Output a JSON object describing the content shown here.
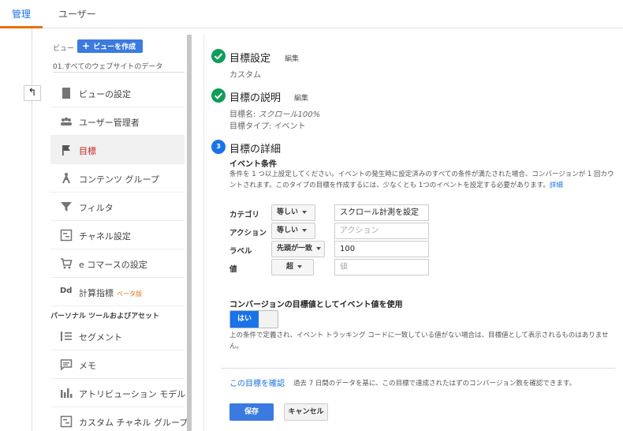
{
  "top_tabs": [
    {
      "label": "管理"
    },
    {
      "label": "ユーザー"
    }
  ],
  "back_button": {
    "icon": "arrow-back-icon"
  },
  "view": {
    "label": "ビュー",
    "create_button": "ビューを作成",
    "name": "01.すべてのウェブサイトのデータ"
  },
  "sidebar": {
    "items": [
      {
        "label": "ビューの設定",
        "icon": "document-icon"
      },
      {
        "label": "ユーザー管理者",
        "icon": "people-icon"
      },
      {
        "label": "目標",
        "icon": "flag-icon"
      },
      {
        "label": "コンテンツ グループ",
        "icon": "person-walk-icon"
      },
      {
        "label": "フィルタ",
        "icon": "funnel-icon"
      },
      {
        "label": "チャネル設定",
        "icon": "channel-icon"
      },
      {
        "label": "e コマースの設定",
        "icon": "cart-icon"
      },
      {
        "label": "計算指標",
        "icon": "dd-icon",
        "badge": "ベータ版"
      }
    ],
    "section_title": "パーソナル ツールおよびアセット",
    "personal_items": [
      {
        "label": "セグメント",
        "icon": "segment-icon"
      },
      {
        "label": "メモ",
        "icon": "memo-icon"
      },
      {
        "label": "アトリビューション モデル",
        "icon": "bar-chart-icon"
      },
      {
        "label": "カスタム チャネル グループ",
        "icon": "channel-group-icon"
      }
    ]
  },
  "steps": {
    "goal_setup": {
      "title": "目標設定",
      "edit": "編集",
      "value": "カスタム"
    },
    "goal_description": {
      "title": "目標の説明",
      "edit": "編集",
      "name_label": "目標名: ",
      "name_value": "スクロール100%",
      "type_label": "目標タイプ: ",
      "type_value": "イベント"
    },
    "goal_details": {
      "number": "3",
      "title": "目標の詳細"
    }
  },
  "event_conditions": {
    "heading": "イベント条件",
    "description": "条件を 1 つ以上設定してください。イベントの発生時に設定済みのすべての条件が満たされた場合、コンバージョンが 1 回カウントされます。このタイプの目標を作成するには、少なくとも 1つのイベントを設定する必要があります。",
    "details_link": "詳細",
    "rows": [
      {
        "label": "カテゴリ",
        "operator": "等しい",
        "value": "スクロール計測を設定",
        "placeholder": ""
      },
      {
        "label": "アクション",
        "operator": "等しい",
        "value": "",
        "placeholder": "アクション"
      },
      {
        "label": "ラベル",
        "operator": "先頭が一致",
        "value": "100",
        "placeholder": ""
      },
      {
        "label": "値",
        "operator": "超",
        "value": "",
        "placeholder": "値"
      }
    ]
  },
  "conversion_value": {
    "heading": "コンバージョンの目標値としてイベント値を使用",
    "toggle_label": "はい",
    "toggle_on": true,
    "description": "上の条件で定義され、イベント トラッキング コードに一致している値がない場合は、目標値として表示されるものはありません。"
  },
  "verify": {
    "link": "この目標を確認",
    "description": "過去 7 日間のデータを基に、この目標で達成されたはずのコンバージョン数を確認できます。"
  },
  "buttons": {
    "save": "保存",
    "cancel": "キャンセル"
  },
  "colors": {
    "accent": "#1a73e8",
    "success": "#0f9d58",
    "tab_indicator": "#e8710a",
    "selected_item_text": "#c5221f"
  }
}
